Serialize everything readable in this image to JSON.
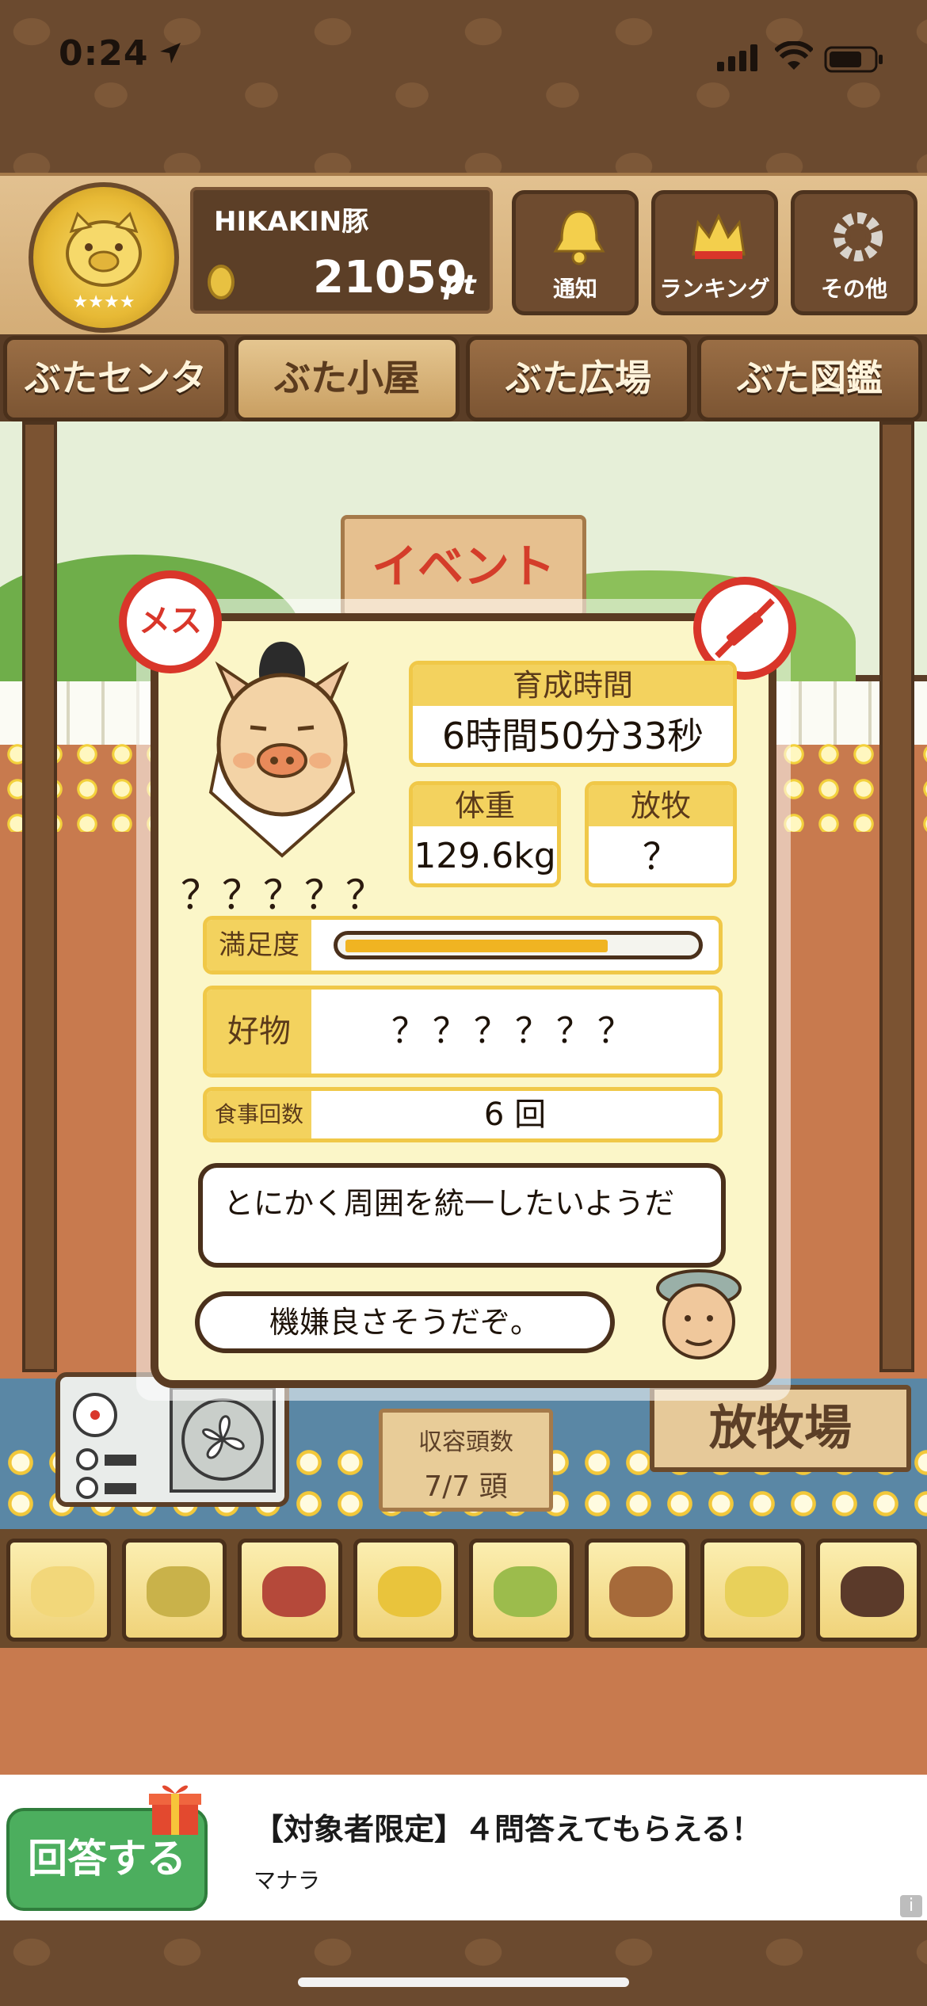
{
  "status_bar": {
    "time": "0:24"
  },
  "header": {
    "player_name": "HIKAKIN豚",
    "points": "21059",
    "points_unit": "pt",
    "buttons": [
      {
        "label": "通知",
        "icon": "bell-icon"
      },
      {
        "label": "ランキング",
        "icon": "crown-icon"
      },
      {
        "label": "その他",
        "icon": "gear-icon"
      }
    ]
  },
  "nav": {
    "tabs": [
      {
        "label": "ぶたセンター",
        "active": false
      },
      {
        "label": "ぶた小屋",
        "active": true
      },
      {
        "label": "ぶた広場",
        "active": false
      },
      {
        "label": "ぶた図鑑",
        "active": false
      }
    ]
  },
  "scene": {
    "event_sign": "イベント",
    "capacity_label": "収容頭数",
    "capacity_value": "7/7 頭",
    "pasture_sign": "放牧場"
  },
  "modal": {
    "gender_badge": "メス",
    "pig_name": "？？？？？",
    "raising_time_label": "育成時間",
    "raising_time_value": "6時間50分33秒",
    "weight_label": "体重",
    "weight_value": "129.6kg",
    "grazing_label": "放牧",
    "grazing_value": "？",
    "satisfaction_label": "満足度",
    "satisfaction_level": 0.76,
    "favorite_label": "好物",
    "favorite_value": "？？？？？？",
    "meals_label": "食事回数",
    "meals_value": "6 回",
    "comment": "とにかく周囲を統一したいようだ",
    "mood": "機嫌良さそうだぞ。"
  },
  "food_items": [
    {
      "icon": "grain-pile-icon",
      "color": "#f2d77a"
    },
    {
      "icon": "mixed-grain-icon",
      "color": "#c9b24a"
    },
    {
      "icon": "sweet-potato-icon",
      "color": "#b5493a"
    },
    {
      "icon": "corn-icon",
      "color": "#e9c43c"
    },
    {
      "icon": "beans-leaves-icon",
      "color": "#9cbc4c"
    },
    {
      "icon": "acorns-icon",
      "color": "#a66a3a"
    },
    {
      "icon": "feed-bowl-icon",
      "color": "#e8d05a"
    },
    {
      "icon": "meatballs-plate-icon",
      "color": "#5b3a2a"
    }
  ],
  "ad": {
    "button_label": "回答する",
    "title": "【対象者限定】４問答えてもらえる！",
    "sponsor": "マナラ",
    "info": "i"
  }
}
